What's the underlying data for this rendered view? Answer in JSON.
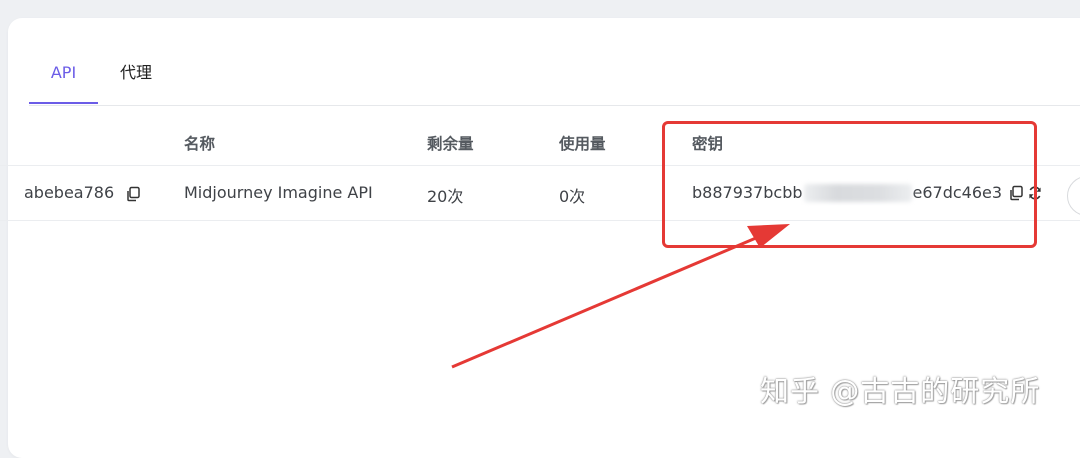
{
  "tabs": [
    {
      "label": "API",
      "active": true
    },
    {
      "label": "代理",
      "active": false
    }
  ],
  "table": {
    "headers": {
      "name": "名称",
      "remaining": "剩余量",
      "used": "使用量",
      "key": "密钥"
    },
    "rows": [
      {
        "id_suffix": "abebea786",
        "name": "Midjourney Imagine API",
        "remaining": "20次",
        "used": "0次",
        "key_prefix": "b887937bcbb",
        "key_suffix": "e67dc46e3"
      }
    ]
  },
  "accent_color": "#6b5ce7",
  "annotation_color": "#e53935",
  "watermark": "知乎 @古古的研究所",
  "icons": [
    "copy-icon",
    "copy-icon",
    "refresh-icon"
  ]
}
